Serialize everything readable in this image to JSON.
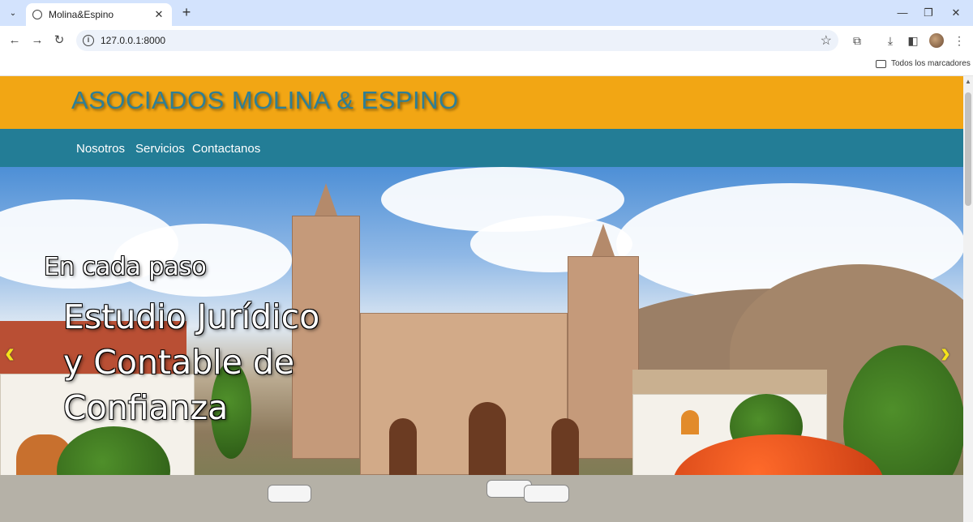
{
  "browser": {
    "tab_title": "Molina&Espino",
    "tab_close": "✕",
    "new_tab": "+",
    "url": "127.0.0.1:8000",
    "bookmarks_folder": "Todos los marcadores",
    "icons": [
      "tab-search-icon",
      "back-icon",
      "forward-icon",
      "reload-icon",
      "site-info-icon",
      "star-icon",
      "extensions-icon",
      "download-icon",
      "sidepanel-icon",
      "profile-avatar",
      "menu-icon",
      "folder-icon"
    ]
  },
  "site": {
    "title": "ASOCIADOS MOLINA & ESPINO",
    "nav": [
      "Nosotros",
      "Servicios",
      "Contactanos"
    ]
  },
  "hero": {
    "kicker": "En cada paso",
    "headline": "Estudio Jurídico y Contable de Confianza",
    "prev": "‹",
    "next": "›"
  },
  "colors": {
    "header_bg": "#f2a614",
    "nav_bg": "#237d96",
    "title_color": "#2e7f96",
    "arrow_color": "#f4e21b"
  }
}
